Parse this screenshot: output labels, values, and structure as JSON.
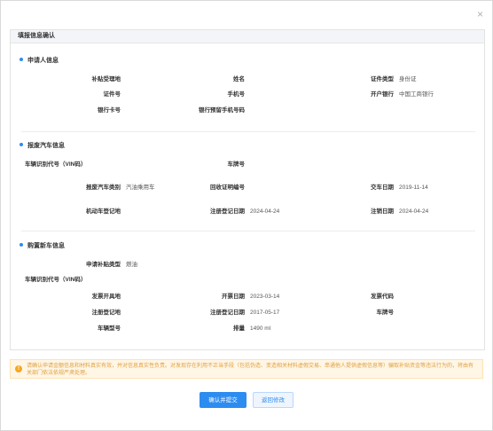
{
  "dialog": {
    "close_glyph": "×"
  },
  "panel": {
    "title": "填报信息确认"
  },
  "applicant": {
    "title": "申请人信息",
    "rows": [
      [
        {
          "label": "补贴受理地",
          "value": ""
        },
        {
          "label": "姓名",
          "value": ""
        },
        {
          "label": "证件类型",
          "value": "身份证"
        }
      ],
      [
        {
          "label": "证件号",
          "value": ""
        },
        {
          "label": "手机号",
          "value": ""
        },
        {
          "label": "开户银行",
          "value": "中国工商银行"
        }
      ],
      [
        {
          "label": "银行卡号",
          "value": ""
        },
        {
          "label": "银行预留手机号码",
          "value": ""
        }
      ]
    ]
  },
  "scrapped_car": {
    "title": "报废汽车信息",
    "vin_label": "车辆识别代号（VIN码）",
    "vin_value": "",
    "plate_label": "车牌号",
    "plate_value": "",
    "rows": [
      [
        {
          "label": "报废汽车类别",
          "value": "汽油乘用车"
        },
        {
          "label": "回收证明编号",
          "value": ""
        },
        {
          "label": "交车日期",
          "value": "2019-11-14"
        }
      ],
      [
        {
          "label": "机动车登记地",
          "value": ""
        },
        {
          "label": "注册登记日期",
          "value": "2024-04-24"
        },
        {
          "label": "注销日期",
          "value": "2024-04-24"
        }
      ]
    ]
  },
  "new_car": {
    "title": "购置新车信息",
    "subsidy_type_label": "申请补贴类型",
    "subsidy_type_value": "燃油",
    "vin_label": "车辆识别代号（VIN码）",
    "vin_value": "",
    "rows": [
      [
        {
          "label": "发票开具地",
          "value": ""
        },
        {
          "label": "开票日期",
          "value": "2023-03-14"
        },
        {
          "label": "发票代码",
          "value": ""
        }
      ],
      [
        {
          "label": "注册登记地",
          "value": ""
        },
        {
          "label": "注册登记日期",
          "value": "2017-05-17"
        },
        {
          "label": "车牌号",
          "value": ""
        }
      ],
      [
        {
          "label": "车辆型号",
          "value": ""
        },
        {
          "label": "排量",
          "value": "1490 ml"
        }
      ]
    ]
  },
  "notice": {
    "icon": "warning-icon",
    "text": "请确认申请金额信息和材料真实有效，并对信息真实性负责。对发现存在利用不正当手段（包括伪造、变造相关材料虚假交易、串通他人提供虚假信息等）骗取补贴资金等违法行为的，将由有关部门依法依规严肃处理。",
    "accent": "#f5a623"
  },
  "buttons": {
    "confirm": "确认并提交",
    "back": "返回修改"
  },
  "colors": {
    "primary": "#2d8cf0"
  }
}
